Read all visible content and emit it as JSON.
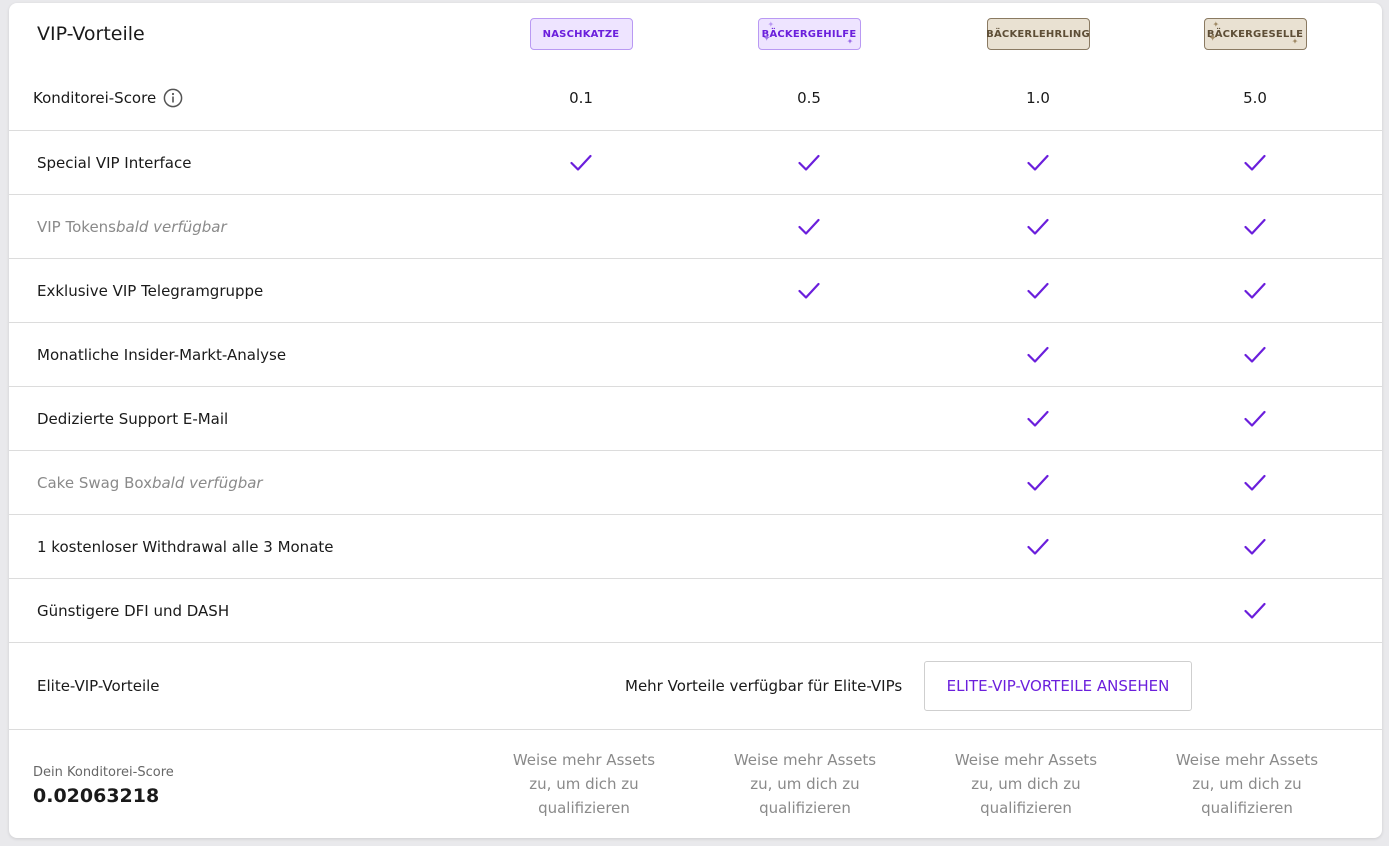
{
  "header": {
    "title": "VIP-Vorteile",
    "tiers": [
      {
        "label": "NASCHKATZE",
        "style": "purple"
      },
      {
        "label": "BÄCKERGEHILFE",
        "style": "purple"
      },
      {
        "label": "BÄCKERLEHRLING",
        "style": "tan"
      },
      {
        "label": "BÄCKERGESELLE",
        "style": "tan"
      }
    ]
  },
  "score_row": {
    "label": "Konditorei-Score",
    "values": [
      "0.1",
      "0.5",
      "1.0",
      "5.0"
    ]
  },
  "features": [
    {
      "label": "Special VIP Interface",
      "note": "",
      "muted": false,
      "tiers": [
        true,
        true,
        true,
        true
      ]
    },
    {
      "label": "VIP Tokens ",
      "note": "bald verfügbar",
      "muted": true,
      "tiers": [
        false,
        true,
        true,
        true
      ]
    },
    {
      "label": "Exklusive VIP Telegramgruppe",
      "note": "",
      "muted": false,
      "tiers": [
        false,
        true,
        true,
        true
      ]
    },
    {
      "label": "Monatliche Insider-Markt-Analyse",
      "note": "",
      "muted": false,
      "tiers": [
        false,
        false,
        true,
        true
      ]
    },
    {
      "label": "Dedizierte Support E-Mail",
      "note": "",
      "muted": false,
      "tiers": [
        false,
        false,
        true,
        true
      ]
    },
    {
      "label": "Cake Swag Box ",
      "note": "bald verfügbar",
      "muted": true,
      "tiers": [
        false,
        false,
        true,
        true
      ]
    },
    {
      "label": "1 kostenloser Withdrawal alle 3 Monate",
      "note": "",
      "muted": false,
      "tiers": [
        false,
        false,
        true,
        true
      ]
    },
    {
      "label": "Günstigere DFI und DASH",
      "note": "",
      "muted": false,
      "tiers": [
        false,
        false,
        false,
        true
      ]
    }
  ],
  "elite": {
    "label": "Elite-VIP-Vorteile",
    "text": "Mehr Vorteile verfügbar für Elite-VIPs",
    "button_label": "ELITE-VIP-VORTEILE ANSEHEN"
  },
  "footer": {
    "score_label": "Dein Konditorei-Score",
    "score_value": "0.02063218",
    "qualify_line1": "Weise mehr Assets",
    "qualify_line2": "zu, um dich zu",
    "qualify_line3": "qualifizieren"
  },
  "colors": {
    "accent": "#6b1fdc",
    "badge_purple_bg": "#eee4ff",
    "badge_tan_bg": "#e9e1d2"
  }
}
